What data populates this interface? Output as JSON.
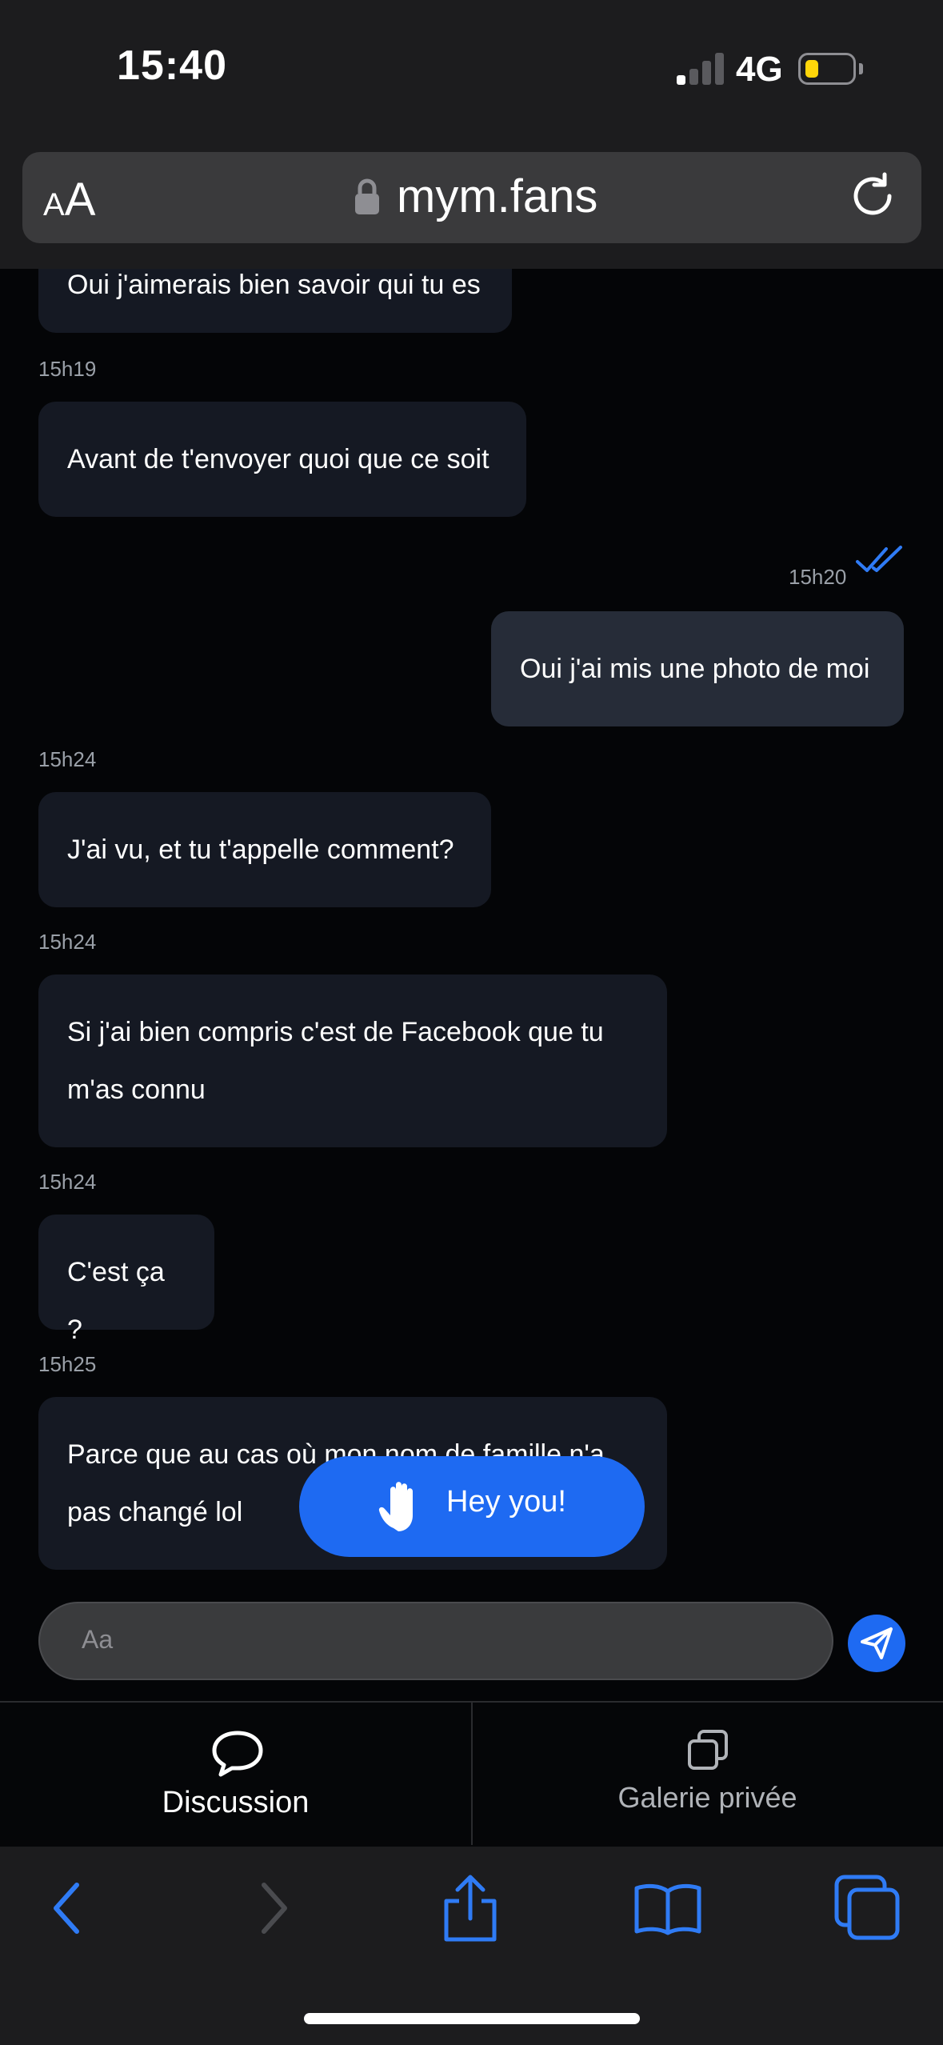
{
  "status_bar": {
    "time": "15:40",
    "network": "4G",
    "battery_color": "#ffd60a"
  },
  "browser": {
    "text_size_label": "AA",
    "url": "mym.fans"
  },
  "messages": [
    {
      "direction": "in",
      "text": "Oui j'aimerais bien savoir qui tu es"
    },
    {
      "direction": "in",
      "time": "15h19",
      "text": "Avant de t'envoyer quoi que ce soit"
    },
    {
      "direction": "out",
      "time": "15h20",
      "text": "Oui j'ai mis une photo de moi"
    },
    {
      "direction": "in",
      "time": "15h24",
      "text": "J'ai vu, et tu t'appelle comment?"
    },
    {
      "direction": "in",
      "time": "15h24",
      "lines": [
        "Si j'ai bien compris c'est de Facebook que tu",
        "m'as connu"
      ]
    },
    {
      "direction": "in",
      "time": "15h24",
      "text": "C'est ça ?"
    },
    {
      "direction": "in",
      "time": "15h25",
      "lines": [
        "Parce que au cas où mon nom de famille n'a",
        "pas changé lol"
      ]
    }
  ],
  "hey_button": {
    "label": "Hey you!"
  },
  "composer": {
    "placeholder": "Aa"
  },
  "tabs": [
    {
      "label": "Discussion",
      "icon": "speech-bubble-icon",
      "active": true
    },
    {
      "label": "Galerie privée",
      "icon": "gallery-icon",
      "active": false
    }
  ],
  "colors": {
    "accent": "#1e6af2",
    "incoming_bubble": "#151923",
    "outgoing_bubble": "#262c38"
  }
}
